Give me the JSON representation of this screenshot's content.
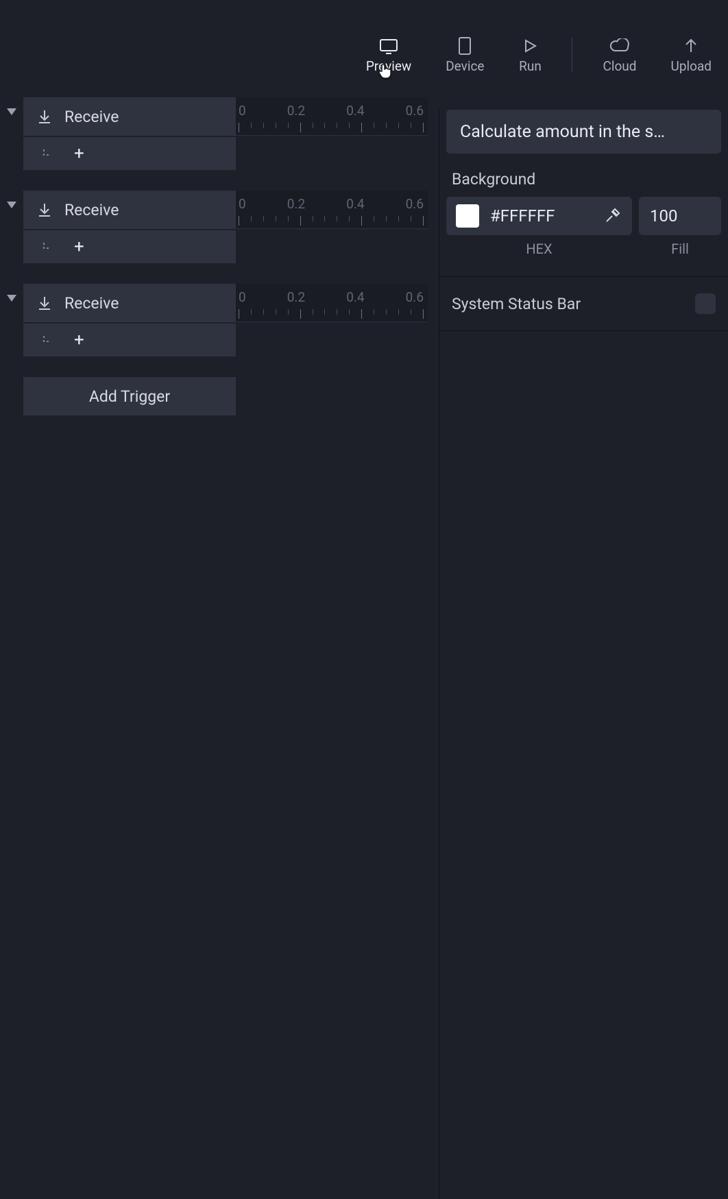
{
  "toolbar": {
    "preview": "Preview",
    "device": "Device",
    "run": "Run",
    "cloud": "Cloud",
    "upload": "Upload"
  },
  "ruler": {
    "ticks": [
      "0",
      "0.2",
      "0.4",
      "0.6"
    ]
  },
  "triggers": [
    {
      "label": "Receive"
    },
    {
      "label": "Receive"
    },
    {
      "label": "Receive"
    }
  ],
  "add_trigger": "Add Trigger",
  "right": {
    "title": "Calculate amount in the s…",
    "background_label": "Background",
    "hex": "#FFFFFF",
    "hex_swatch": "#FFFFFF",
    "hex_sub": "HEX",
    "fill": "100",
    "fill_sub": "Fill",
    "status_label": "System Status Bar"
  }
}
